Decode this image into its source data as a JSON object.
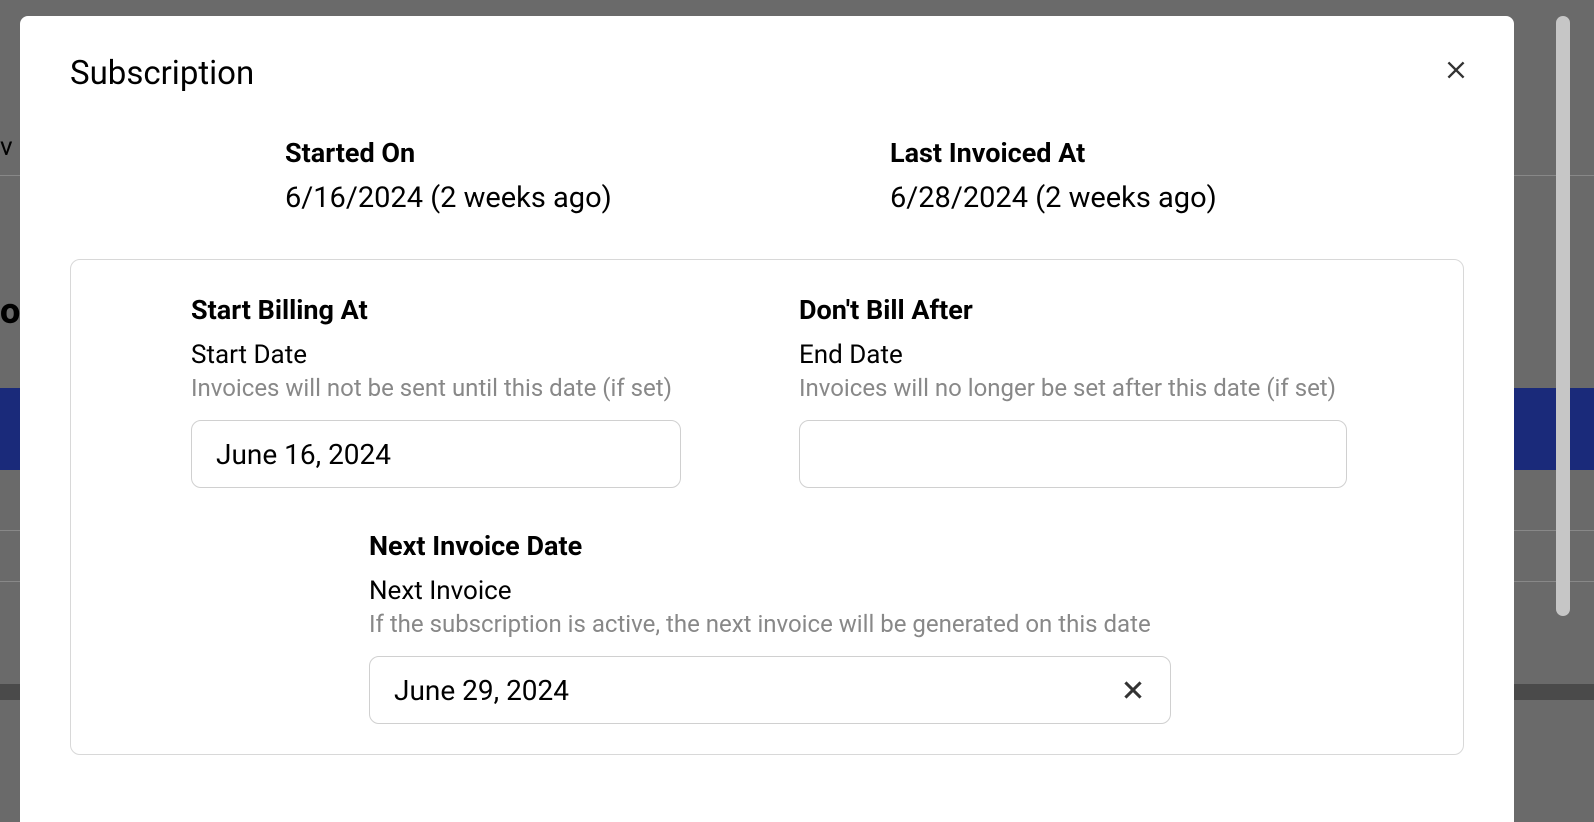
{
  "modal": {
    "title": "Subscription"
  },
  "info": {
    "started_on_label": "Started On",
    "started_on_value": "6/16/2024 (2 weeks ago)",
    "last_invoiced_label": "Last Invoiced At",
    "last_invoiced_value": "6/28/2024 (2 weeks ago)"
  },
  "form": {
    "start_billing": {
      "section_title": "Start Billing At",
      "field_label": "Start Date",
      "help": "Invoices will not be sent until this date (if set)",
      "value": "June 16, 2024"
    },
    "dont_bill_after": {
      "section_title": "Don't Bill After",
      "field_label": "End Date",
      "help": "Invoices will no longer be set after this date (if set)",
      "value": ""
    },
    "next_invoice": {
      "section_title": "Next Invoice Date",
      "field_label": "Next Invoice",
      "help": "If the subscription is active, the next invoice will be generated on this date",
      "value": "June 29, 2024"
    }
  }
}
